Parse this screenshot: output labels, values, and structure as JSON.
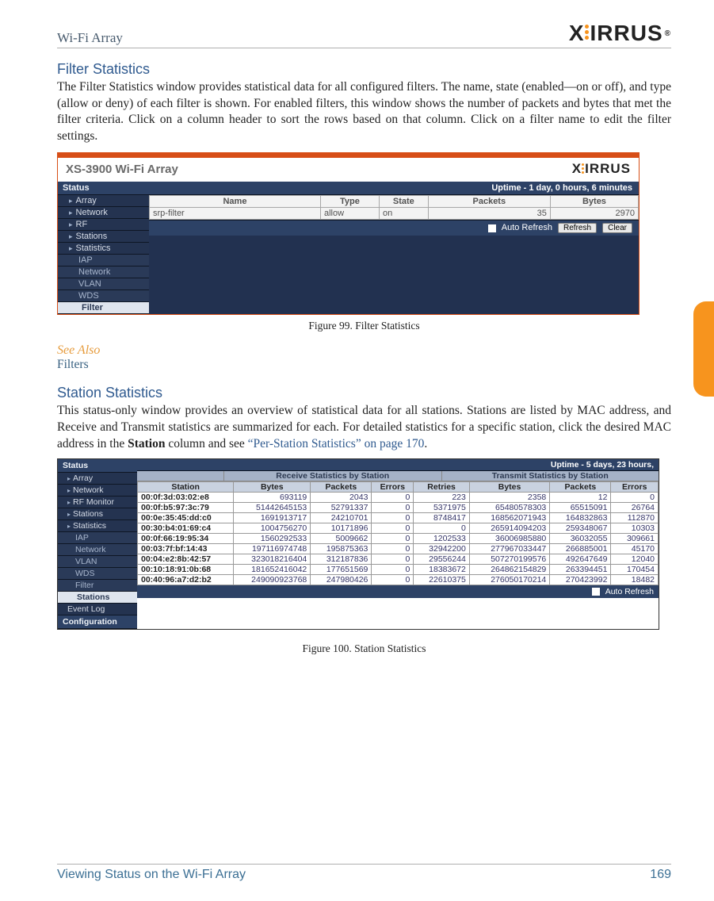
{
  "header": {
    "left": "Wi-Fi Array",
    "logo_text": "XIRRUS",
    "logo_reg": "®"
  },
  "sidetab": {},
  "filter_stats": {
    "heading": "Filter Statistics",
    "body": "The Filter Statistics window provides statistical data for all configured filters. The name, state (enabled—on or off), and type (allow or deny) of each filter is shown. For enabled filters, this window shows the number of packets and bytes that met the filter criteria. Click on a column header to sort the rows based on that column. Click on a filter name to edit the filter settings."
  },
  "fig99": {
    "caption": "Figure 99. Filter Statistics",
    "array_title": "XS-3900 Wi-Fi Array",
    "uptime_label": "",
    "uptime_value": "Uptime - 1 day, 0 hours, 6 minutes",
    "nav": {
      "header": "Status",
      "items": [
        "Array",
        "Network",
        "RF",
        "Stations",
        "Statistics"
      ],
      "sub": [
        "IAP",
        "Network",
        "VLAN",
        "WDS"
      ],
      "selected": "Filter"
    },
    "columns": [
      "Name",
      "Type",
      "State",
      "Packets",
      "Bytes"
    ],
    "row": {
      "name": "srp-filter",
      "type": "allow",
      "state": "on",
      "packets": "35",
      "bytes": "2970"
    },
    "auto_refresh_label": "Auto Refresh",
    "buttons": {
      "refresh": "Refresh",
      "clear": "Clear"
    }
  },
  "see_also": {
    "label": "See Also",
    "link": "Filters"
  },
  "station_stats": {
    "heading": "Station Statistics",
    "body_pre": "This status-only window provides an overview of statistical data for all stations. Stations are listed by MAC address, and Receive and Transmit statistics are summarized for each. For detailed statistics for a specific station, click the desired MAC address in the ",
    "station_word": "Station",
    "body_mid": " column and see ",
    "link_text": "“Per-Station Statistics” on page 170",
    "body_post": "."
  },
  "fig100": {
    "caption": "Figure 100. Station Statistics",
    "uptime": "Uptime - 5 days, 23 hours,",
    "nav": {
      "header": "Status",
      "items": [
        "Array",
        "Network",
        "RF Monitor",
        "Stations",
        "Statistics"
      ],
      "sub": [
        "IAP",
        "Network",
        "VLAN",
        "WDS",
        "Filter"
      ],
      "selected": "Stations",
      "after": [
        "Event Log"
      ],
      "config": "Configuration"
    },
    "group_rx": "Receive Statistics by Station",
    "group_tx": "Transmit Statistics by Station",
    "columns": [
      "Station",
      "Bytes",
      "Packets",
      "Errors",
      "Retries",
      "Bytes",
      "Packets",
      "Errors"
    ],
    "rows": [
      {
        "mac": "00:0f:3d:03:02:e8",
        "rx_b": "693119",
        "rx_p": "2043",
        "rx_e": "0",
        "rx_r": "223",
        "tx_b": "2358",
        "tx_p": "12",
        "tx_e": "0"
      },
      {
        "mac": "00:0f:b5:97:3c:79",
        "rx_b": "51442645153",
        "rx_p": "52791337",
        "rx_e": "0",
        "rx_r": "5371975",
        "tx_b": "65480578303",
        "tx_p": "65515091",
        "tx_e": "26764"
      },
      {
        "mac": "00:0e:35:45:dd:c0",
        "rx_b": "1691913717",
        "rx_p": "24210701",
        "rx_e": "0",
        "rx_r": "8748417",
        "tx_b": "168562071943",
        "tx_p": "164832863",
        "tx_e": "112870"
      },
      {
        "mac": "00:30:b4:01:69:c4",
        "rx_b": "1004756270",
        "rx_p": "10171896",
        "rx_e": "0",
        "rx_r": "0",
        "tx_b": "265914094203",
        "tx_p": "259348067",
        "tx_e": "10303"
      },
      {
        "mac": "00:0f:66:19:95:34",
        "rx_b": "1560292533",
        "rx_p": "5009662",
        "rx_e": "0",
        "rx_r": "1202533",
        "tx_b": "36006985880",
        "tx_p": "36032055",
        "tx_e": "309661"
      },
      {
        "mac": "00:03:7f:bf:14:43",
        "rx_b": "197116974748",
        "rx_p": "195875363",
        "rx_e": "0",
        "rx_r": "32942200",
        "tx_b": "277967033447",
        "tx_p": "266885001",
        "tx_e": "45170"
      },
      {
        "mac": "00:04:e2:8b:42:57",
        "rx_b": "323018216404",
        "rx_p": "312187836",
        "rx_e": "0",
        "rx_r": "29556244",
        "tx_b": "507270199576",
        "tx_p": "492647649",
        "tx_e": "12040"
      },
      {
        "mac": "00:10:18:91:0b:68",
        "rx_b": "181652416042",
        "rx_p": "177651569",
        "rx_e": "0",
        "rx_r": "18383672",
        "tx_b": "264862154829",
        "tx_p": "263394451",
        "tx_e": "170454"
      },
      {
        "mac": "00:40:96:a7:d2:b2",
        "rx_b": "249090923768",
        "rx_p": "247980426",
        "rx_e": "0",
        "rx_r": "22610375",
        "tx_b": "276050170214",
        "tx_p": "270423992",
        "tx_e": "18482"
      }
    ],
    "auto_refresh_label": "Auto Refresh"
  },
  "footer": {
    "left": "Viewing Status on the Wi-Fi Array",
    "right": "169"
  }
}
